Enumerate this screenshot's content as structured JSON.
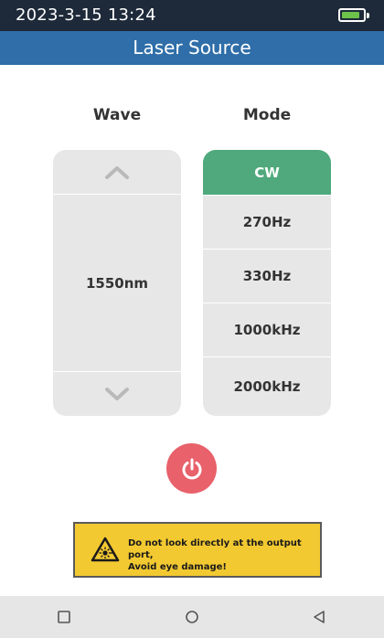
{
  "status_bar": {
    "time": "2023-3-15 13:24",
    "battery_level": 0.86
  },
  "title": "Laser Source",
  "wave": {
    "header": "Wave",
    "value": "1550nm",
    "up_icon": "chevron-up-icon",
    "down_icon": "chevron-down-icon"
  },
  "mode": {
    "header": "Mode",
    "options": [
      "CW",
      "270Hz",
      "330Hz",
      "1000kHz",
      "2000kHz"
    ],
    "selected": "CW"
  },
  "power_icon": "power-icon",
  "warning": {
    "line1": "Do not look directly at the output port,",
    "line2": "Avoid eye damage!",
    "icon": "laser-warning-icon"
  },
  "nav": {
    "icons": [
      "square-icon",
      "circle-icon",
      "triangle-back-icon"
    ]
  },
  "colors": {
    "status_bar": "#1e2a3a",
    "title_bar": "#2f6ea8",
    "mode_selected": "#4fa97c",
    "power_button": "#e8616b",
    "warning_bg": "#f3c931",
    "battery": "#6cc24a"
  }
}
